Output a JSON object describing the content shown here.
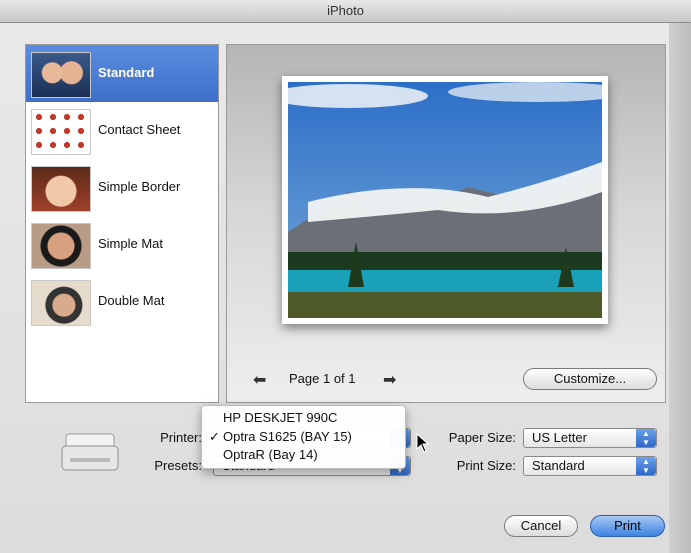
{
  "window": {
    "title": "iPhoto"
  },
  "themes": [
    {
      "label": "Standard",
      "selected": true
    },
    {
      "label": "Contact Sheet",
      "selected": false
    },
    {
      "label": "Simple Border",
      "selected": false
    },
    {
      "label": "Simple Mat",
      "selected": false
    },
    {
      "label": "Double Mat",
      "selected": false
    }
  ],
  "preview": {
    "page_label": "Page 1 of 1",
    "customize_label": "Customize..."
  },
  "printer_menu": {
    "items": [
      {
        "label": "HP DESKJET 990C",
        "checked": false
      },
      {
        "label": "Optra S1625 (BAY 15)",
        "checked": true
      },
      {
        "label": "OptraR (Bay 14)",
        "checked": false
      }
    ],
    "check_glyph": "✓"
  },
  "controls": {
    "printer_label": "Printer:",
    "presets_label": "Presets:",
    "presets_value": "Standard",
    "paper_size_label": "Paper Size:",
    "paper_size_value": "US Letter",
    "print_size_label": "Print Size:",
    "print_size_value": "Standard"
  },
  "buttons": {
    "cancel": "Cancel",
    "print": "Print"
  },
  "colors": {
    "selection": "#3e6fc9",
    "default_button": "#3e82e0"
  }
}
